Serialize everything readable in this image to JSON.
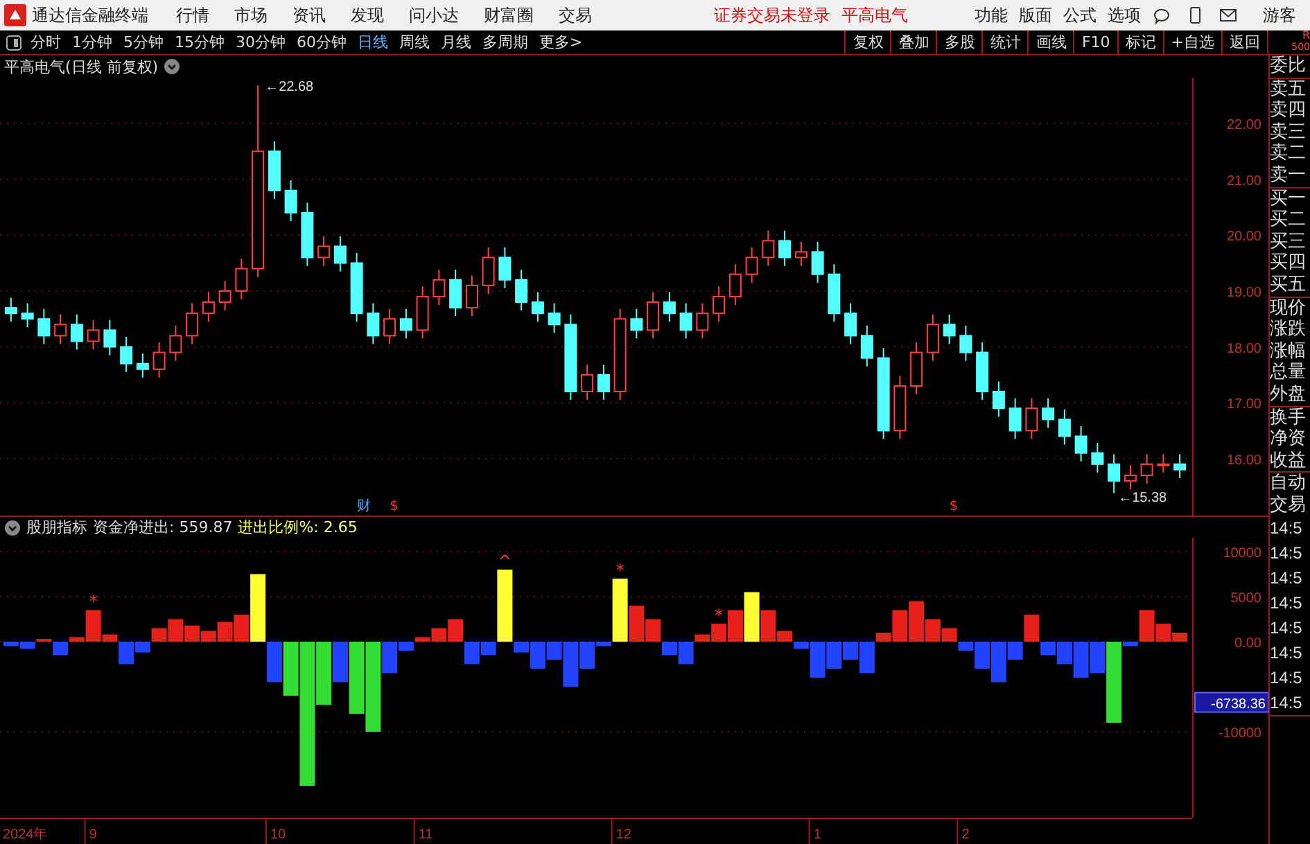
{
  "app_bar": {
    "title": "通达信金融终端",
    "menus": [
      "行情",
      "市场",
      "资讯",
      "发现",
      "问小达",
      "财富圈",
      "交易"
    ],
    "notice": "证券交易未登录",
    "stock_name": "平高电气",
    "right_menus": [
      "功能",
      "版面",
      "公式",
      "选项"
    ],
    "user": "游客"
  },
  "toolbar": {
    "periods": [
      {
        "label": "分时",
        "selected": false
      },
      {
        "label": "1分钟",
        "selected": false
      },
      {
        "label": "5分钟",
        "selected": false
      },
      {
        "label": "15分钟",
        "selected": false
      },
      {
        "label": "30分钟",
        "selected": false
      },
      {
        "label": "60分钟",
        "selected": false
      },
      {
        "label": "日线",
        "selected": true
      },
      {
        "label": "周线",
        "selected": false
      },
      {
        "label": "月线",
        "selected": false
      },
      {
        "label": "多周期",
        "selected": false
      },
      {
        "label": "更多>",
        "selected": false
      }
    ],
    "actions": [
      "复权",
      "叠加",
      "多股",
      "统计",
      "画线",
      "F10",
      "标记",
      "+自选",
      "返回"
    ]
  },
  "price_chart": {
    "title": "平高电气(日线 前复权)",
    "peak_label": "←22.68",
    "low_label": "←15.38",
    "chart_data": {
      "type": "candlestick",
      "grid": true,
      "ylim": [
        14.98,
        22.82
      ],
      "ohlc": [
        [
          18.7,
          18.88,
          18.45,
          18.6
        ],
        [
          18.6,
          18.78,
          18.35,
          18.5
        ],
        [
          18.5,
          18.68,
          18.05,
          18.2
        ],
        [
          18.2,
          18.58,
          18.05,
          18.4
        ],
        [
          18.4,
          18.58,
          17.95,
          18.1
        ],
        [
          18.1,
          18.48,
          17.95,
          18.3
        ],
        [
          18.3,
          18.48,
          17.85,
          18.0
        ],
        [
          18.0,
          18.18,
          17.55,
          17.7
        ],
        [
          17.7,
          17.88,
          17.45,
          17.6
        ],
        [
          17.6,
          18.08,
          17.45,
          17.9
        ],
        [
          17.9,
          18.38,
          17.75,
          18.2
        ],
        [
          18.2,
          18.78,
          18.05,
          18.6
        ],
        [
          18.6,
          18.98,
          18.45,
          18.8
        ],
        [
          18.8,
          19.18,
          18.65,
          19.0
        ],
        [
          19.0,
          19.58,
          18.85,
          19.4
        ],
        [
          19.4,
          22.68,
          19.25,
          21.5
        ],
        [
          21.5,
          21.68,
          20.65,
          20.8
        ],
        [
          20.8,
          20.98,
          20.25,
          20.4
        ],
        [
          20.4,
          20.58,
          19.45,
          19.6
        ],
        [
          19.6,
          19.98,
          19.45,
          19.8
        ],
        [
          19.8,
          19.98,
          19.35,
          19.5
        ],
        [
          19.5,
          19.68,
          18.45,
          18.6
        ],
        [
          18.6,
          18.78,
          18.05,
          18.2
        ],
        [
          18.2,
          18.68,
          18.05,
          18.5
        ],
        [
          18.5,
          18.68,
          18.15,
          18.3
        ],
        [
          18.3,
          19.08,
          18.15,
          18.9
        ],
        [
          18.9,
          19.38,
          18.75,
          19.2
        ],
        [
          19.2,
          19.38,
          18.55,
          18.7
        ],
        [
          18.7,
          19.28,
          18.55,
          19.1
        ],
        [
          19.1,
          19.78,
          18.95,
          19.6
        ],
        [
          19.6,
          19.78,
          19.05,
          19.2
        ],
        [
          19.2,
          19.38,
          18.65,
          18.8
        ],
        [
          18.8,
          18.98,
          18.45,
          18.6
        ],
        [
          18.6,
          18.78,
          18.25,
          18.4
        ],
        [
          18.4,
          18.58,
          17.05,
          17.2
        ],
        [
          17.2,
          17.68,
          17.05,
          17.5
        ],
        [
          17.5,
          17.68,
          17.05,
          17.2
        ],
        [
          17.2,
          18.68,
          17.05,
          18.5
        ],
        [
          18.5,
          18.68,
          18.15,
          18.3
        ],
        [
          18.3,
          18.98,
          18.15,
          18.8
        ],
        [
          18.8,
          18.98,
          18.45,
          18.6
        ],
        [
          18.6,
          18.78,
          18.15,
          18.3
        ],
        [
          18.3,
          18.78,
          18.15,
          18.6
        ],
        [
          18.6,
          19.08,
          18.45,
          18.9
        ],
        [
          18.9,
          19.48,
          18.75,
          19.3
        ],
        [
          19.3,
          19.78,
          19.15,
          19.6
        ],
        [
          19.6,
          20.08,
          19.45,
          19.9
        ],
        [
          19.9,
          20.08,
          19.45,
          19.6
        ],
        [
          19.6,
          19.88,
          19.45,
          19.7
        ],
        [
          19.7,
          19.88,
          19.15,
          19.3
        ],
        [
          19.3,
          19.48,
          18.45,
          18.6
        ],
        [
          18.6,
          18.78,
          18.05,
          18.2
        ],
        [
          18.2,
          18.38,
          17.65,
          17.8
        ],
        [
          17.8,
          17.98,
          16.35,
          16.5
        ],
        [
          16.5,
          17.48,
          16.35,
          17.3
        ],
        [
          17.3,
          18.08,
          17.15,
          17.9
        ],
        [
          17.9,
          18.58,
          17.75,
          18.4
        ],
        [
          18.4,
          18.58,
          18.05,
          18.2
        ],
        [
          18.2,
          18.38,
          17.75,
          17.9
        ],
        [
          17.9,
          18.08,
          17.05,
          17.2
        ],
        [
          17.2,
          17.38,
          16.75,
          16.9
        ],
        [
          16.9,
          17.08,
          16.35,
          16.5
        ],
        [
          16.5,
          17.08,
          16.35,
          16.9
        ],
        [
          16.9,
          17.08,
          16.55,
          16.7
        ],
        [
          16.7,
          16.88,
          16.25,
          16.4
        ],
        [
          16.4,
          16.58,
          15.95,
          16.1
        ],
        [
          16.1,
          16.28,
          15.75,
          15.9
        ],
        [
          15.9,
          16.08,
          15.38,
          15.6
        ],
        [
          15.6,
          15.88,
          15.45,
          15.7
        ],
        [
          15.7,
          16.08,
          15.55,
          15.9
        ],
        [
          15.9,
          16.08,
          15.75,
          15.9
        ],
        [
          15.9,
          16.08,
          15.65,
          15.8
        ]
      ],
      "yticks": [
        {
          "value": 16,
          "label": "16.00"
        },
        {
          "value": 17,
          "label": "17.00"
        },
        {
          "value": 18,
          "label": "18.00"
        },
        {
          "value": 19,
          "label": "19.00"
        },
        {
          "value": 20,
          "label": "20.00"
        },
        {
          "value": 21,
          "label": "21.00"
        },
        {
          "value": 22,
          "label": "22.00"
        }
      ]
    },
    "event_marks": [
      {
        "kind": "finance",
        "label": "财"
      },
      {
        "kind": "dollar",
        "label": "$"
      },
      {
        "kind": "dollar",
        "label": "$"
      }
    ]
  },
  "indicator": {
    "name": "股朋指标",
    "net_flow": "资金净进出: 559.87",
    "ratio": "进出比例%: 2.65",
    "current_value_tag": "-6738.36",
    "chart_data": {
      "type": "bar",
      "grid": true,
      "ylim": [
        -19538,
        11538
      ],
      "series": [
        {
          "values": [
            -500,
            -800,
            300,
            -1500,
            500,
            3500,
            800,
            -2500,
            -1200,
            1500,
            2500,
            1800,
            1200,
            2200,
            3000,
            7500,
            -4500,
            -6000,
            -16000,
            -7000,
            -4500,
            -8000,
            -10000,
            -3500,
            -1000,
            500,
            1500,
            2500,
            -2500,
            -1500,
            8000,
            -1200,
            -3000,
            -2000,
            -5000,
            -3000,
            -500,
            7000,
            4000,
            2500,
            -1500,
            -2500,
            800,
            2000,
            3500,
            5500,
            3500,
            1200,
            -800,
            -4000,
            -3000,
            -2000,
            -3500,
            1000,
            3500,
            4500,
            2500,
            1500,
            -1000,
            -3000,
            -4500,
            -2000,
            3000,
            -1500,
            -2500,
            -4000,
            -3500,
            -9000,
            -500,
            3500,
            2000,
            1000
          ]
        }
      ],
      "yticks": [
        {
          "value": 10000,
          "label": "10000"
        },
        {
          "value": 5000,
          "label": "5000"
        },
        {
          "value": 0,
          "label": "0.00"
        },
        {
          "value": -10000,
          "label": "-10000"
        }
      ]
    },
    "signal_marks": [
      {
        "label": "*"
      },
      {
        "label": "^"
      },
      {
        "label": "*"
      },
      {
        "label": "*"
      }
    ]
  },
  "x_axis": {
    "year": "2024年",
    "months": [
      "9",
      "10",
      "11",
      "12",
      "1",
      "2"
    ]
  },
  "side_panel": {
    "header": [
      "R",
      "500"
    ],
    "groups": [
      [
        "委比"
      ],
      [
        "卖五",
        "卖四",
        "卖三",
        "卖二",
        "卖一"
      ],
      [
        "买一",
        "买二",
        "买三",
        "买四",
        "买五"
      ],
      [
        "现价",
        "涨跌",
        "涨幅",
        "总量",
        "外盘"
      ],
      [
        "换手",
        "净资",
        "收益"
      ]
    ],
    "auto": "自动",
    "trade": "交易",
    "times": [
      "14:5",
      "14:5",
      "14:5",
      "14:5",
      "14:5",
      "14:5",
      "14:5",
      "14:5"
    ]
  }
}
